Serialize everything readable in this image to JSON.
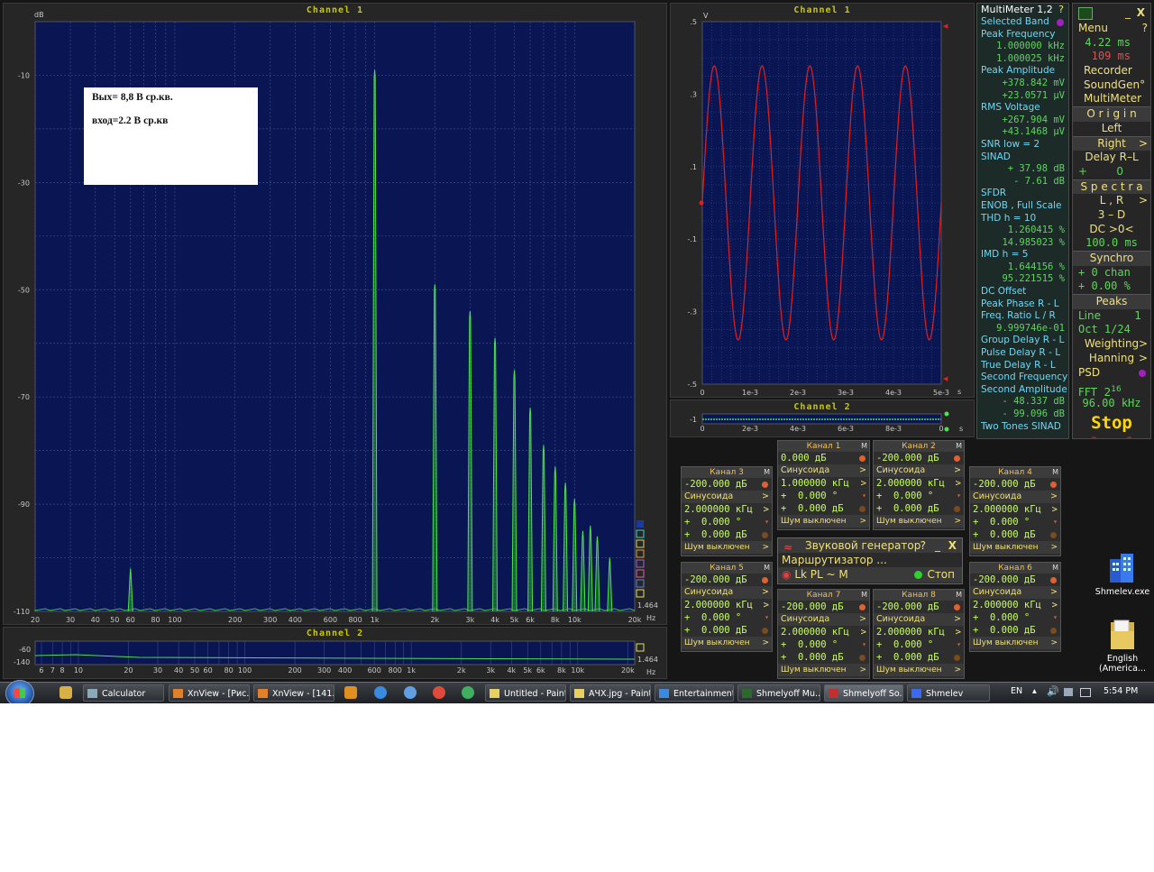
{
  "spectrum": {
    "title": "Channel 1",
    "y_unit": "dB",
    "y_ticks": [
      "-10",
      "-30",
      "-50",
      "-70",
      "-90",
      "-110"
    ],
    "x_ticks": [
      "20",
      "30",
      "40",
      "50",
      "60",
      "80",
      "100",
      "200",
      "300",
      "400",
      "600",
      "800",
      "1k",
      "2k",
      "3k",
      "4k",
      "5k",
      "6k",
      "8k",
      "10k",
      "20k"
    ],
    "x_unit": "Hz",
    "note_line1": "Вых= 8,8 В ср.кв.",
    "note_line2": "вход=2.2 В ср.кв",
    "scale_value": "1.464",
    "bottom_title": "Channel 2",
    "bottom_y_ticks": [
      "-60",
      "-140"
    ],
    "bottom_x_ticks": [
      "6",
      "7",
      "8",
      "10",
      "20",
      "30",
      "40",
      "50",
      "60",
      "80",
      "100",
      "200",
      "300",
      "400",
      "600",
      "800",
      "1k",
      "2k",
      "3k",
      "4k",
      "5k",
      "6k",
      "8k",
      "10k",
      "20k"
    ],
    "bottom_x_unit": "Hz",
    "bottom_scale_value": "1.464"
  },
  "chart_data": [
    {
      "type": "bar",
      "title": "Channel 1",
      "ylabel": "dB",
      "xlabel": "Hz",
      "x_scale": "log",
      "xlim": [
        20,
        20000
      ],
      "ylim": [
        -110,
        0
      ],
      "series": [
        {
          "x": [
            60,
            1000,
            2000,
            3000,
            4000,
            5000,
            6000,
            7000,
            8000,
            9000,
            10000,
            11000,
            12000,
            13000,
            15000
          ],
          "values": [
            -102,
            -9,
            -49,
            -54,
            -59,
            -65,
            -72,
            -79,
            -83,
            -86,
            -89,
            -95,
            -94,
            -96,
            -100
          ]
        }
      ],
      "grid": true
    },
    {
      "type": "line",
      "title": "Channel 1",
      "ylabel": "V",
      "xlabel": "s",
      "xlim": [
        0,
        0.005
      ],
      "ylim": [
        -0.5,
        0.5
      ],
      "x_ticks": [
        "0",
        "1e-3",
        "2e-3",
        "3e-3",
        "4e-3",
        "5e-3"
      ],
      "y_ticks": [
        ".5",
        ".3",
        ".1",
        "-.1",
        "-.3",
        "-.5"
      ],
      "series": [
        {
          "frequency_hz": 1000,
          "amplitude_v": 0.378,
          "values_desc": "sine"
        }
      ],
      "grid": true
    }
  ],
  "scope": {
    "title": "Channel 1",
    "y_unit": "V",
    "x_unit": "s",
    "y_ticks": [
      ".5",
      ".3",
      ".1",
      "-.1",
      "-.3",
      "-.5"
    ],
    "x_ticks": [
      "0",
      "1e-3",
      "2e-3",
      "3e-3",
      "4e-3",
      "5e-3"
    ],
    "ch2_title": "Channel 2",
    "ch2_x_ticks": [
      "0",
      "2e-3",
      "4e-3",
      "6e-3",
      "8e-3",
      "0"
    ],
    "ch2_unit": "s",
    "ch2_y": "-1"
  },
  "multimeter": {
    "title": "MultiMeter 1,2",
    "help": "?",
    "rows": [
      {
        "t": "Selected Band",
        "k": "l",
        "dot": true
      },
      {
        "t": "Peak Frequency",
        "k": "l"
      },
      {
        "t": "1.000000 kHz",
        "k": "v"
      },
      {
        "t": "1.000025 kHz",
        "k": "v"
      },
      {
        "t": "Peak Amplitude",
        "k": "l"
      },
      {
        "t": "+378.842 mV",
        "k": "v"
      },
      {
        "t": "+23.0571 µV",
        "k": "v"
      },
      {
        "t": "RMS Voltage",
        "k": "l"
      },
      {
        "t": "+267.904 mV",
        "k": "v"
      },
      {
        "t": "+43.1468 µV",
        "k": "v"
      },
      {
        "t": "SNR      low =   2",
        "k": "l"
      },
      {
        "t": "SINAD",
        "k": "l"
      },
      {
        "t": "+  37.98 dB",
        "k": "v"
      },
      {
        "t": "-    7.61 dB",
        "k": "v"
      },
      {
        "t": "SFDR",
        "k": "l"
      },
      {
        "t": "ENOB , Full Scale",
        "k": "l"
      },
      {
        "t": "THD      h =  10",
        "k": "l"
      },
      {
        "t": "1.260415 %",
        "k": "v"
      },
      {
        "t": "14.985023 %",
        "k": "v"
      },
      {
        "t": "IMD       h =   5",
        "k": "l"
      },
      {
        "t": "1.644156 %",
        "k": "v"
      },
      {
        "t": "95.221515 %",
        "k": "v"
      },
      {
        "t": "DC Offset",
        "k": "l"
      },
      {
        "t": "Peak Phase R - L",
        "k": "l"
      },
      {
        "t": "Freq. Ratio  L / R",
        "k": "l"
      },
      {
        "t": "9.999746e-01",
        "k": "v"
      },
      {
        "t": "Group Delay R - L",
        "k": "l"
      },
      {
        "t": "Pulse Delay R - L",
        "k": "l"
      },
      {
        "t": "True Delay R - L",
        "k": "l"
      },
      {
        "t": "Second Frequency",
        "k": "l"
      },
      {
        "t": "Second Amplitude",
        "k": "l"
      },
      {
        "t": "-   48.337 dB",
        "k": "v"
      },
      {
        "t": "-   99.096 dB",
        "k": "v"
      },
      {
        "t": "Two Tones SINAD",
        "k": "l"
      }
    ]
  },
  "menu": {
    "close": "X",
    "menu_label": "Menu",
    "help": "?",
    "time1": "4.22 ms",
    "time2": "109 ms",
    "recorder": "Recorder",
    "soundgen": "SoundGen°",
    "multimeter": "MultiMeter",
    "origin": "O r i g i n",
    "left": "Left",
    "right": "Right",
    "delay": "Delay R–L",
    "delay_val": "0",
    "spectra": "S p e c t r a",
    "lr": "L , R",
    "threed": "3 – D",
    "dc": "DC  >0<",
    "dc_val": "100.0 ms",
    "synchro": "Synchro",
    "synchro_chan": "0 chan",
    "synchro_pct": "0.00 %",
    "peaks": "Peaks",
    "line": "Line",
    "line_val": "1",
    "oct": "Oct  1/24",
    "weighting": "Weighting",
    "hanning": "Hanning",
    "psd": "PSD",
    "fft": "FFT",
    "fft_base": "2",
    "fft_exp": "16",
    "rate": "96.00 kHz",
    "stop": "Stop"
  },
  "generator": {
    "title": "Звуковой генератор",
    "help": "?",
    "min": "_",
    "close": "X",
    "router": "Маршрутизатор ...",
    "lk": "Lk",
    "pl": "PL",
    "tilde": "~",
    "m": "M",
    "stop": "Стоп",
    "channels": [
      {
        "id": "k1",
        "name": "Канал 1",
        "level": "0.000 дБ",
        "wave": "Синусоида",
        "freq": "1.000000 кГц",
        "phase": "0.000 °",
        "amp": "0.000 дБ",
        "noise": "Шум выключен",
        "m": "M"
      },
      {
        "id": "k2",
        "name": "Канал 2",
        "level": "-200.000 дБ",
        "wave": "Синусоида",
        "freq": "2.000000 кГц",
        "phase": "0.000 °",
        "amp": "0.000 дБ",
        "noise": "Шум выключен",
        "m": "M"
      },
      {
        "id": "k3",
        "name": "Канал 3",
        "level": "-200.000 дБ",
        "wave": "Синусоида",
        "freq": "2.000000 кГц",
        "phase": "0.000 °",
        "amp": "0.000 дБ",
        "noise": "Шум выключен",
        "m": "M"
      },
      {
        "id": "k4",
        "name": "Канал 4",
        "level": "-200.000 дБ",
        "wave": "Синусоида",
        "freq": "2.000000 кГц",
        "phase": "0.000 °",
        "amp": "0.000 дБ",
        "noise": "Шум выключен",
        "m": "M"
      },
      {
        "id": "k5",
        "name": "Канал 5",
        "level": "-200.000 дБ",
        "wave": "Синусоида",
        "freq": "2.000000 кГц",
        "phase": "0.000 °",
        "amp": "0.000 дБ",
        "noise": "Шум выключен",
        "m": "M"
      },
      {
        "id": "k6",
        "name": "Канал 6",
        "level": "-200.000 дБ",
        "wave": "Синусоида",
        "freq": "2.000000 кГц",
        "phase": "0.000 °",
        "amp": "0.000 дБ",
        "noise": "Шум выключен",
        "m": "M"
      },
      {
        "id": "k7",
        "name": "Канал 7",
        "level": "-200.000 дБ",
        "wave": "Синусоида",
        "freq": "2.000000 кГц",
        "phase": "0.000 °",
        "amp": "0.000 дБ",
        "noise": "Шум выключен",
        "m": "M"
      },
      {
        "id": "k8",
        "name": "Канал 8",
        "level": "-200.000 дБ",
        "wave": "Синусоида",
        "freq": "2.000000 кГц",
        "phase": "0.000 °",
        "amp": "0.000 дБ",
        "noise": "Шум выключен",
        "m": "M"
      }
    ]
  },
  "desktop_icons": [
    {
      "label": "Shmelev.exe"
    },
    {
      "label": "English (America..."
    }
  ],
  "taskbar": {
    "items": [
      "Calculator",
      "XnView - [Рис...",
      "XnView - [141...",
      "Untitled - Paint",
      "АЧХ.jpg - Paint",
      "Entertainment...",
      "Shmelyoff Mu...",
      "Shmelyoff So...",
      "Shmelev"
    ],
    "lang": "EN",
    "clock": "5:54 PM"
  },
  "colors": {
    "plot_bg": "#0a1654",
    "trace_green": "#4ee04e",
    "trace_red": "#e02020",
    "label_yellow": "#c8c800"
  }
}
